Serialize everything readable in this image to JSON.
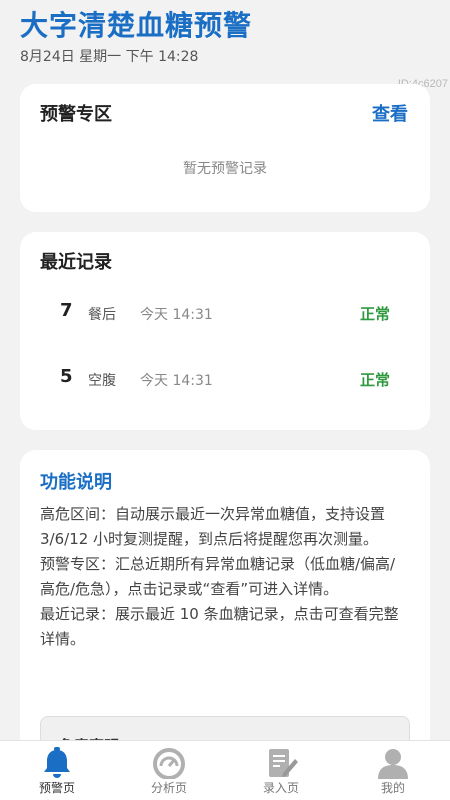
{
  "header": {
    "title": "大字清楚血糖预警",
    "date": "8月24日 星期一 下午 14:28",
    "device_id": "ID:4c6207"
  },
  "alert_card": {
    "title": "预警专区",
    "view_label": "查看",
    "empty_text": "暂无预警记录"
  },
  "recent_card": {
    "title": "最近记录",
    "records": [
      {
        "value": "7",
        "type": "餐后",
        "time": "今天 14:31",
        "status": "正常"
      },
      {
        "value": "5",
        "type": "空腹",
        "time": "今天 14:31",
        "status": "正常"
      }
    ]
  },
  "help_card": {
    "title": "功能说明",
    "paragraphs": [
      "高危区间：自动展示最近一次异常血糖值，支持设置 3/6/12 小时复测提醒，到点后将提醒您再次测量。",
      "预警专区：汇总近期所有异常血糖记录（低血糖/偏高/高危/危急），点击记录或“查看”可进入详情。",
      "最近记录：展示最近 10 条血糖记录，点击可查看完整详情。"
    ],
    "disclaimer_title": "免责声明"
  },
  "tabbar": {
    "tabs": [
      {
        "label": "预警页",
        "icon": "bell-icon",
        "active": true
      },
      {
        "label": "分析页",
        "icon": "gauge-icon",
        "active": false
      },
      {
        "label": "录入页",
        "icon": "edit-document-icon",
        "active": false
      },
      {
        "label": "我的",
        "icon": "user-icon",
        "active": false
      }
    ]
  },
  "colors": {
    "accent": "#1a6fc4",
    "normal_status": "#2e9a3e",
    "background": "#f2f2f2",
    "inactive_icon": "#b0b0b0"
  }
}
